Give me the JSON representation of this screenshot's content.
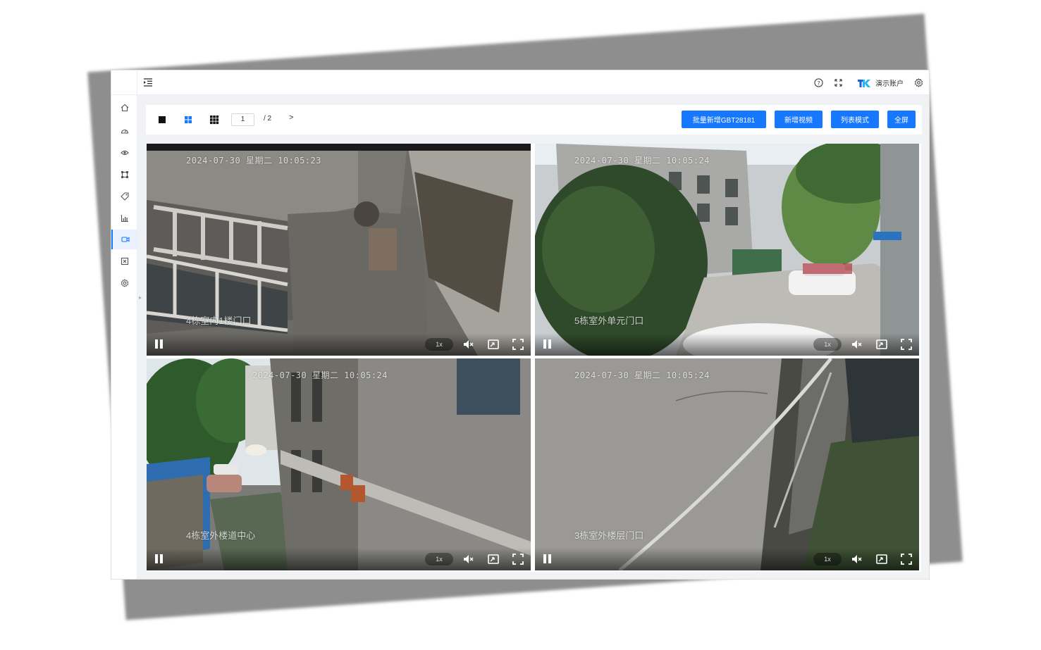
{
  "header": {
    "account_name": "演示账户",
    "icons": [
      "menu-fold-icon",
      "help-icon",
      "fullscreen-icon",
      "settings-icon"
    ]
  },
  "sidebar": {
    "items": [
      {
        "icon": "home-icon",
        "active": false
      },
      {
        "icon": "dashboard-icon",
        "active": false
      },
      {
        "icon": "eye-icon",
        "active": false
      },
      {
        "icon": "frame-icon",
        "active": false
      },
      {
        "icon": "tag-icon",
        "active": false
      },
      {
        "icon": "bar-chart-icon",
        "active": false
      },
      {
        "icon": "video-camera-icon",
        "active": true
      },
      {
        "icon": "app-icon",
        "active": false
      },
      {
        "icon": "settings-icon",
        "active": false
      }
    ]
  },
  "toolbar": {
    "layouts": [
      "layout-1-icon",
      "layout-4-icon",
      "layout-9-icon"
    ],
    "active_layout": "layout-4-icon",
    "page_current": "1",
    "page_total_label": "/  2",
    "next_label": ">",
    "buttons": {
      "batch_add": "批量新增GBT28181",
      "add_video": "新增视频",
      "list_mode": "列表模式",
      "fullscreen": "全屏"
    }
  },
  "videos": [
    {
      "timestamp": "2024-07-30 星期二 10:05:23",
      "name": "4栋室内1楼门口",
      "speed": "1x"
    },
    {
      "timestamp": "2024-07-30 星期二 10:05:24",
      "name": "5栋室外单元门口",
      "speed": "1x"
    },
    {
      "timestamp": "2024-07-30 星期二 10:05:24",
      "name": "4栋室外楼道中心",
      "speed": "1x"
    },
    {
      "timestamp": "2024-07-30 星期二 10:05:24",
      "name": "3栋室外楼层门口",
      "speed": "1x"
    }
  ],
  "colors": {
    "primary": "#1677ff",
    "page_bg": "#f0f2f5"
  }
}
